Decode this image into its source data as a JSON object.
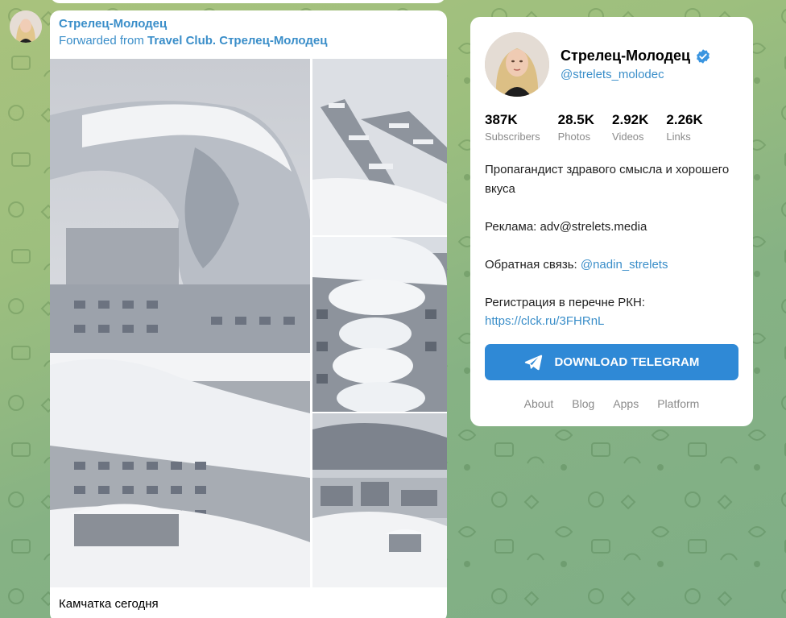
{
  "post": {
    "channel_name": "Стрелец-Молодец",
    "forwarded_prefix": "Forwarded from",
    "forwarded_source": "Travel Club. Стрелец-Молодец",
    "caption": "Камчатка сегодня",
    "photo_icons": [
      "snowdrift-photo",
      "snowy-street-photo",
      "snow-balconies-photo",
      "snowy-town-photo"
    ]
  },
  "card": {
    "title": "Стрелец-Молодец",
    "handle": "@strelets_molodec",
    "verified_icon": "verified-badge-icon",
    "stats": [
      {
        "value": "387K",
        "label": "Subscribers"
      },
      {
        "value": "28.5K",
        "label": "Photos"
      },
      {
        "value": "2.92K",
        "label": "Videos"
      },
      {
        "value": "2.26K",
        "label": "Links"
      }
    ],
    "desc_line1": "Пропагандист здравого смысла и хорошего вкуса",
    "ad_text": "Реклама: adv@strelets.media",
    "feedback_prefix": "Обратная связь:",
    "feedback_link": "@nadin_strelets",
    "rkn_text": "Регистрация в перечне РКН:",
    "rkn_link": "https://clck.ru/3FHRnL",
    "download_label": "DOWNLOAD TELEGRAM",
    "footer_links": [
      "About",
      "Blog",
      "Apps",
      "Platform"
    ]
  },
  "colors": {
    "accent": "#2f89d6",
    "link": "#3a8ec9",
    "background": "#9dbf7e"
  }
}
